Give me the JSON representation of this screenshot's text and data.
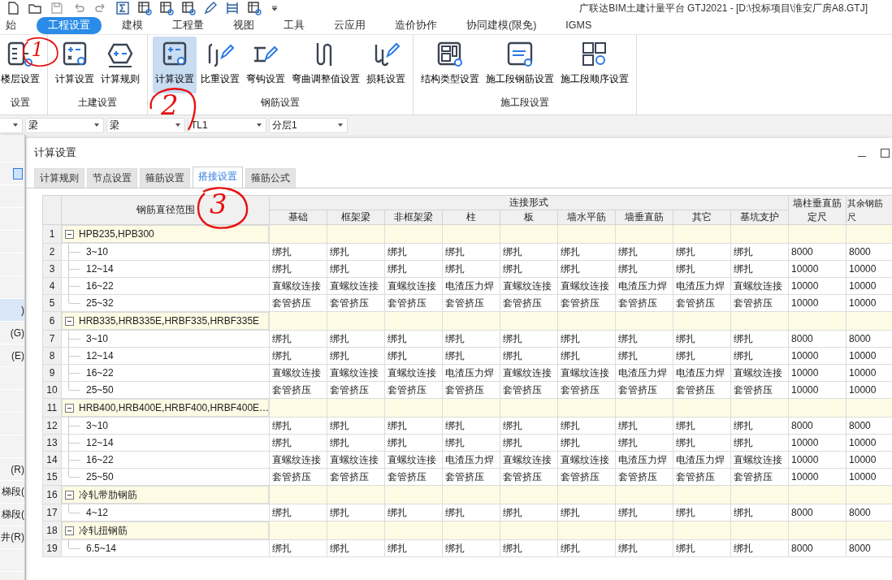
{
  "window": {
    "title": "广联达BIM土建计量平台 GTJ2021 - [D:\\投标项目\\淮安厂房A8.GTJ]"
  },
  "menu": [
    {
      "label": "始",
      "selected": false
    },
    {
      "label": "工程设置",
      "selected": true
    },
    {
      "label": "建模",
      "selected": false
    },
    {
      "label": "工程量",
      "selected": false
    },
    {
      "label": "视图",
      "selected": false
    },
    {
      "label": "工具",
      "selected": false
    },
    {
      "label": "云应用",
      "selected": false
    },
    {
      "label": "造价协作",
      "selected": false
    },
    {
      "label": "协同建模(限免)",
      "selected": false
    },
    {
      "label": "IGMS",
      "selected": false
    }
  ],
  "ribbon": [
    {
      "label": "设置",
      "items": [
        {
          "label": "楼层设置",
          "selected": false
        }
      ]
    },
    {
      "label": "土建设置",
      "items": [
        {
          "label": "计算设置",
          "selected": false
        },
        {
          "label": "计算规则",
          "selected": false
        }
      ]
    },
    {
      "label": "钢筋设置",
      "items": [
        {
          "label": "计算设置",
          "selected": true
        },
        {
          "label": "比重设置",
          "selected": false
        },
        {
          "label": "弯钩设置",
          "selected": false
        },
        {
          "label": "弯曲调整值设置",
          "selected": false
        },
        {
          "label": "损耗设置",
          "selected": false
        }
      ]
    },
    {
      "label": "施工段设置",
      "items": [
        {
          "label": "结构类型设置",
          "selected": false
        },
        {
          "label": "施工段钢筋设置",
          "selected": false
        },
        {
          "label": "施工段顺序设置",
          "selected": false
        }
      ]
    }
  ],
  "filters": [
    {
      "value": "梁"
    },
    {
      "value": "梁"
    },
    {
      "value": "TL1"
    },
    {
      "value": "分层1"
    }
  ],
  "sidebar": {
    "items": [
      {
        "selected": false
      },
      {
        "selected": false
      },
      {
        "selected": false
      },
      {
        "selected": false
      },
      {
        "selected": false
      },
      {
        "selected": false
      },
      {
        "selected": false
      },
      {
        "label": ")",
        "selected": true
      },
      {
        "label": "(G)",
        "selected": false
      },
      {
        "label": "(E)",
        "selected": false
      },
      {
        "selected": false
      },
      {
        "selected": false
      },
      {
        "selected": false
      },
      {
        "selected": false
      },
      {
        "label": "(R)",
        "selected": false
      },
      {
        "label": "梯段(",
        "selected": false
      },
      {
        "label": "梯段(",
        "selected": false
      },
      {
        "label": "井(R)",
        "selected": false
      },
      {
        "selected": false
      }
    ]
  },
  "dialog": {
    "title": "计算设置",
    "tabs": [
      {
        "label": "计算规则",
        "selected": false
      },
      {
        "label": "节点设置",
        "selected": false
      },
      {
        "label": "箍筋设置",
        "selected": false
      },
      {
        "label": "搭接设置",
        "selected": true
      },
      {
        "label": "箍筋公式",
        "selected": false
      }
    ],
    "table": {
      "range_header": "钢筋直径范围",
      "group_header": "连接形式",
      "connection_columns": [
        "基础",
        "框架梁",
        "非框架梁",
        "柱",
        "板",
        "墙水平筋",
        "墙垂直筋",
        "其它",
        "基坑支护"
      ],
      "length_columns": [
        [
          "墙柱垂直筋",
          "定尺"
        ],
        [
          "其余钢筋",
          "尺"
        ]
      ],
      "groups": [
        {
          "no": "1",
          "label": "HPB235,HPB300",
          "expanded": true,
          "rows": [
            {
              "no": "2",
              "range": "3~10",
              "cells": [
                "绑扎",
                "绑扎",
                "绑扎",
                "绑扎",
                "绑扎",
                "绑扎",
                "绑扎",
                "绑扎",
                "绑扎"
              ],
              "lengths": [
                "8000",
                "8000"
              ]
            },
            {
              "no": "3",
              "range": "12~14",
              "cells": [
                "绑扎",
                "绑扎",
                "绑扎",
                "绑扎",
                "绑扎",
                "绑扎",
                "绑扎",
                "绑扎",
                "绑扎"
              ],
              "lengths": [
                "10000",
                "10000"
              ]
            },
            {
              "no": "4",
              "range": "16~22",
              "cells": [
                "直螺纹连接",
                "直螺纹连接",
                "直螺纹连接",
                "电渣压力焊",
                "直螺纹连接",
                "直螺纹连接",
                "电渣压力焊",
                "电渣压力焊",
                "直螺纹连接"
              ],
              "lengths": [
                "10000",
                "10000"
              ]
            },
            {
              "no": "5",
              "range": "25~32",
              "cells": [
                "套管挤压",
                "套管挤压",
                "套管挤压",
                "套管挤压",
                "套管挤压",
                "套管挤压",
                "套管挤压",
                "套管挤压",
                "套管挤压"
              ],
              "lengths": [
                "10000",
                "10000"
              ]
            }
          ]
        },
        {
          "no": "6",
          "label": "HRB335,HRB335E,HRBF335,HRBF335E",
          "expanded": true,
          "rows": [
            {
              "no": "7",
              "range": "3~10",
              "cells": [
                "绑扎",
                "绑扎",
                "绑扎",
                "绑扎",
                "绑扎",
                "绑扎",
                "绑扎",
                "绑扎",
                "绑扎"
              ],
              "lengths": [
                "8000",
                "8000"
              ]
            },
            {
              "no": "8",
              "range": "12~14",
              "cells": [
                "绑扎",
                "绑扎",
                "绑扎",
                "绑扎",
                "绑扎",
                "绑扎",
                "绑扎",
                "绑扎",
                "绑扎"
              ],
              "lengths": [
                "10000",
                "10000"
              ]
            },
            {
              "no": "9",
              "range": "16~22",
              "cells": [
                "直螺纹连接",
                "直螺纹连接",
                "直螺纹连接",
                "电渣压力焊",
                "直螺纹连接",
                "直螺纹连接",
                "电渣压力焊",
                "电渣压力焊",
                "直螺纹连接"
              ],
              "lengths": [
                "10000",
                "10000"
              ]
            },
            {
              "no": "10",
              "range": "25~50",
              "cells": [
                "套管挤压",
                "套管挤压",
                "套管挤压",
                "套管挤压",
                "套管挤压",
                "套管挤压",
                "套管挤压",
                "套管挤压",
                "套管挤压"
              ],
              "lengths": [
                "10000",
                "10000"
              ]
            }
          ]
        },
        {
          "no": "11",
          "label": "HRB400,HRB400E,HRBF400,HRBF400E…",
          "expanded": true,
          "rows": [
            {
              "no": "12",
              "range": "3~10",
              "cells": [
                "绑扎",
                "绑扎",
                "绑扎",
                "绑扎",
                "绑扎",
                "绑扎",
                "绑扎",
                "绑扎",
                "绑扎"
              ],
              "lengths": [
                "8000",
                "8000"
              ]
            },
            {
              "no": "13",
              "range": "12~14",
              "cells": [
                "绑扎",
                "绑扎",
                "绑扎",
                "绑扎",
                "绑扎",
                "绑扎",
                "绑扎",
                "绑扎",
                "绑扎"
              ],
              "lengths": [
                "10000",
                "10000"
              ]
            },
            {
              "no": "14",
              "range": "16~22",
              "cells": [
                "直螺纹连接",
                "直螺纹连接",
                "直螺纹连接",
                "电渣压力焊",
                "直螺纹连接",
                "直螺纹连接",
                "电渣压力焊",
                "电渣压力焊",
                "直螺纹连接"
              ],
              "lengths": [
                "10000",
                "10000"
              ]
            },
            {
              "no": "15",
              "range": "25~50",
              "cells": [
                "套管挤压",
                "套管挤压",
                "套管挤压",
                "套管挤压",
                "套管挤压",
                "套管挤压",
                "套管挤压",
                "套管挤压",
                "套管挤压"
              ],
              "lengths": [
                "10000",
                "10000"
              ]
            }
          ]
        },
        {
          "no": "16",
          "label": "冷轧带肋钢筋",
          "expanded": true,
          "rows": [
            {
              "no": "17",
              "range": "4~12",
              "cells": [
                "绑扎",
                "绑扎",
                "绑扎",
                "绑扎",
                "绑扎",
                "绑扎",
                "绑扎",
                "绑扎",
                "绑扎"
              ],
              "lengths": [
                "8000",
                "8000"
              ]
            }
          ]
        },
        {
          "no": "18",
          "label": "冷轧扭钢筋",
          "expanded": true,
          "rows": [
            {
              "no": "19",
              "range": "6.5~14",
              "cells": [
                "绑扎",
                "绑扎",
                "绑扎",
                "绑扎",
                "绑扎",
                "绑扎",
                "绑扎",
                "绑扎",
                "绑扎"
              ],
              "lengths": [
                "8000",
                "8000"
              ]
            }
          ]
        }
      ]
    }
  },
  "annotations": [
    {
      "label": "1"
    },
    {
      "label": "2"
    },
    {
      "label": "3"
    }
  ]
}
